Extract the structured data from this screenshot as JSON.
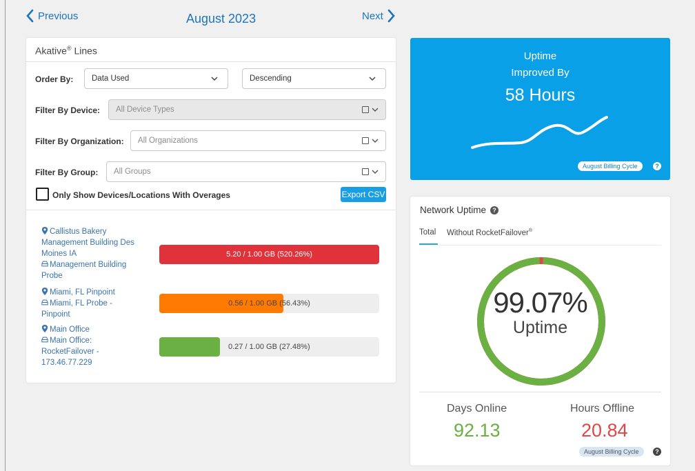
{
  "nav": {
    "previous_label": "Previous",
    "next_label": "Next",
    "month_title": "August 2023"
  },
  "lines": {
    "title": "Akative",
    "title_sup": "®",
    "title_suffix": " Lines",
    "order_by_label": "Order By:",
    "order_by_value": "Data Used",
    "order_dir_value": "Descending",
    "filter_device_label": "Filter By Device:",
    "filter_device_placeholder": "All Device Types",
    "filter_org_label": "Filter By Organization:",
    "filter_org_placeholder": "All Organizations",
    "filter_group_label": "Filter By Group:",
    "filter_group_placeholder": "All Groups",
    "overages_label": "Only Show Devices/Locations With Overages",
    "export_label": "Export CSV",
    "devices": [
      {
        "location_lines": [
          "Callistus Bakery",
          "Management Building Des",
          "Moines IA"
        ],
        "device_lines": [
          "Management Building",
          "Probe"
        ],
        "usage_text": "5.20 / 1.00 GB (520.26%)",
        "fill_fraction": 1.0,
        "color": "#e0323a"
      },
      {
        "location_lines": [
          "Miami, FL Pinpoint"
        ],
        "device_lines": [
          "Miami, FL Probe -",
          "Pinpoint"
        ],
        "usage_text": "0.56 / 1.00 GB (56.43%)",
        "fill_fraction": 0.5643,
        "color": "#ff7a00"
      },
      {
        "location_lines": [
          "Main Office"
        ],
        "device_lines": [
          "Main Office:",
          "RocketFailover -",
          "173.46.77.229"
        ],
        "usage_text": "0.27 / 1.00 GB (27.48%)",
        "fill_fraction": 0.2748,
        "color": "#6ab043"
      }
    ]
  },
  "improved": {
    "line1": "Uptime",
    "line2": "Improved By",
    "line3": "58 Hours",
    "cycle_label": "August Billing Cycle",
    "help_glyph": "?"
  },
  "network": {
    "title": "Network Uptime",
    "tab_total": "Total",
    "tab_without": "Without RocketFailover",
    "tab_without_sup": "®",
    "uptime_percent": "99.07%",
    "uptime_fraction": 0.9907,
    "uptime_label": "Uptime",
    "days_online_label": "Days Online",
    "days_online_value": "92.13",
    "hours_offline_label": "Hours Offline",
    "hours_offline_value": "20.84",
    "cycle_label": "August Billing Cycle",
    "help_glyph": "?",
    "colors": {
      "online": "#6ab043",
      "offline": "#e04848"
    }
  }
}
